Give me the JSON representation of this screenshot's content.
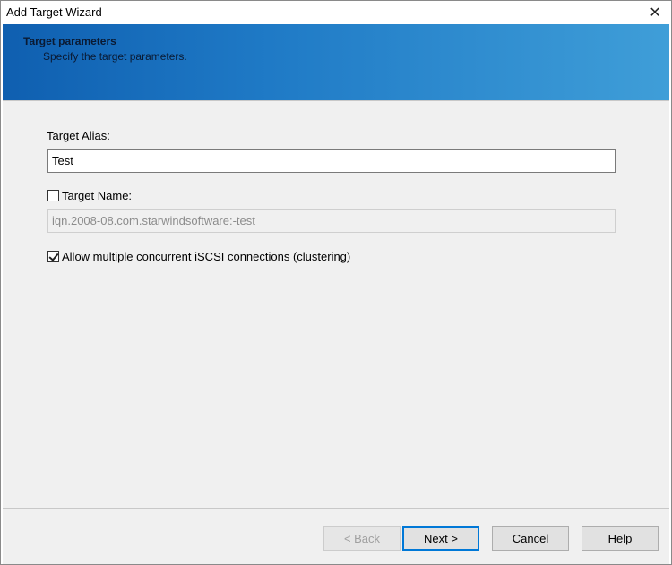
{
  "window": {
    "title": "Add Target Wizard",
    "close_glyph": "✕"
  },
  "banner": {
    "title": "Target parameters",
    "subtitle": "Specify the target parameters."
  },
  "form": {
    "alias_label": "Target Alias:",
    "alias_value": "Test",
    "name_checkbox_checked": false,
    "name_label": "Target Name:",
    "name_value": "iqn.2008-08.com.starwindsoftware:-test",
    "clustering_checked": true,
    "clustering_label": "Allow multiple concurrent iSCSI connections (clustering)"
  },
  "footer": {
    "back_label": "< Back",
    "next_label": "Next >",
    "cancel_label": "Cancel",
    "help_label": "Help"
  },
  "colors": {
    "banner_start": "#0f5fb0",
    "banner_end": "#3f9ed8",
    "default_button_border": "#0078d7"
  }
}
